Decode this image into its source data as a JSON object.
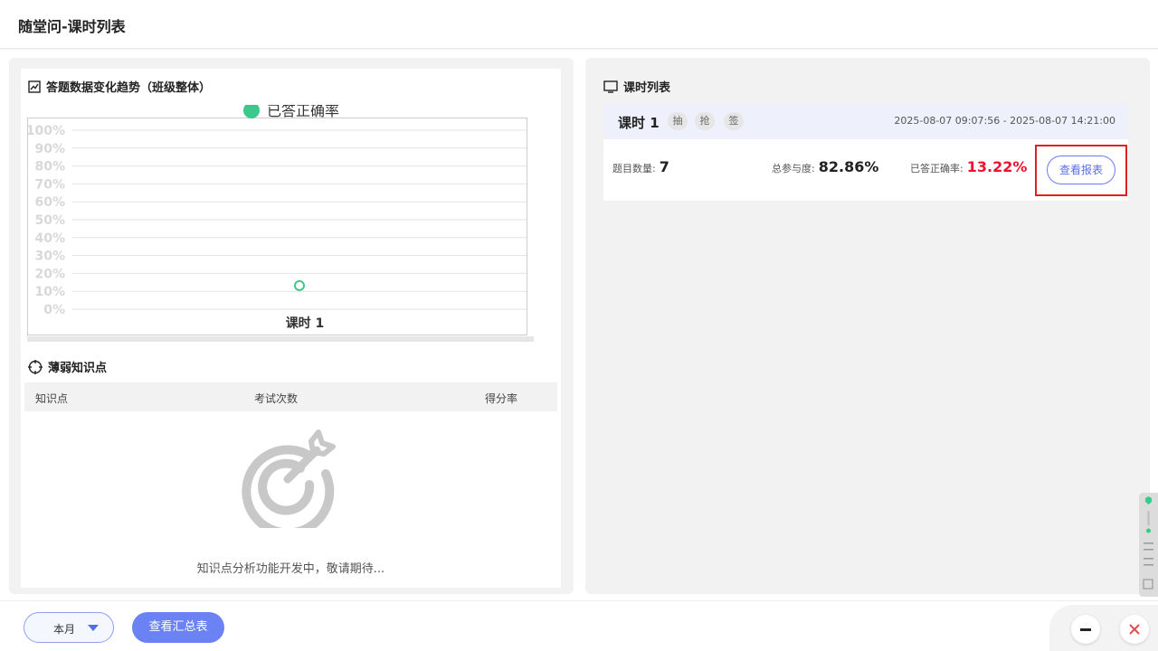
{
  "window": {
    "title": "随堂问-课时列表"
  },
  "trend": {
    "section_title": "答题数据变化趋势（班级整体）",
    "icon": "line-chart-icon"
  },
  "chart_data": {
    "type": "line",
    "title": "",
    "legend": [
      "已答正确率"
    ],
    "legend_position": "top-center",
    "categories": [
      "课时 1"
    ],
    "series": [
      {
        "name": "已答正确率",
        "values": [
          13.22
        ],
        "color": "#3cc88a"
      }
    ],
    "y_ticks": [
      "0%",
      "10%",
      "20%",
      "30%",
      "40%",
      "50%",
      "60%",
      "70%",
      "80%",
      "90%",
      "100%"
    ],
    "ylim": [
      0,
      100
    ],
    "grid": true
  },
  "weak": {
    "section_title": "薄弱知识点",
    "icon": "crosshair-icon",
    "columns": [
      "知识点",
      "考试次数",
      "得分率"
    ],
    "empty_icon": "target-icon",
    "empty_text": "知识点分析功能开发中，敬请期待..."
  },
  "lessons": {
    "section_title": "课时列表",
    "icon": "monitor-icon",
    "items": [
      {
        "name": "课时 1",
        "tags": [
          "抽",
          "抢",
          "签"
        ],
        "time_range": "2025-08-07 09:07:56 - 2025-08-07 14:21:00",
        "question_count_label": "题目数量:",
        "question_count": "7",
        "participation_label": "总参与度:",
        "participation": "82.86%",
        "accuracy_label": "已答正确率:",
        "accuracy": "13.22%",
        "report_button": "查看报表"
      }
    ]
  },
  "footer": {
    "period_selected": "本月",
    "summary_button": "查看汇总表",
    "minimize_icon": "minimize-icon",
    "close_icon": "close-icon"
  },
  "colors": {
    "accent": "#6a82f4",
    "series_green": "#3cc88a",
    "accuracy_red": "#f0112d",
    "highlight_red": "#e02020"
  }
}
